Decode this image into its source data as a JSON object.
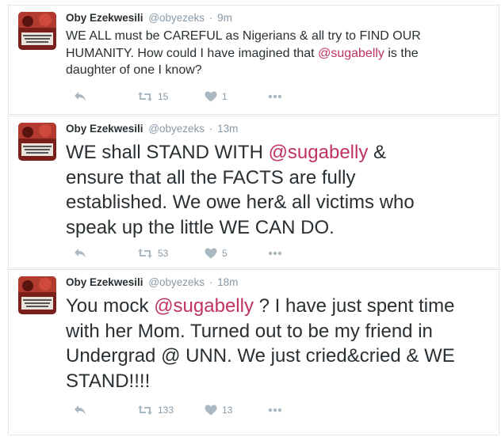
{
  "tweets": [
    {
      "fullname": "Oby Ezekwesili",
      "username": "@obyezeks",
      "separator": "·",
      "time": "9m",
      "text_parts": [
        "WE ALL must be CAREFUL as Nigerians & all try to FIND OUR HUMANITY. How could I have imagined that ",
        "@sugabelly",
        " is the daughter of one I know?"
      ],
      "retweets": "15",
      "likes": "1"
    },
    {
      "fullname": "Oby Ezekwesili",
      "username": "@obyezeks",
      "separator": "·",
      "time": "13m",
      "text_parts": [
        "WE shall STAND WITH ",
        "@sugabelly",
        " & ensure that all the FACTS are fully established. We owe her& all victims who speak up the little WE CAN DO."
      ],
      "retweets": "53",
      "likes": "5"
    },
    {
      "fullname": "Oby Ezekwesili",
      "username": "@obyezeks",
      "separator": "·",
      "time": "18m",
      "text_parts": [
        "You mock ",
        "@sugabelly",
        " ? I have just spent time with her Mom. Turned out to be my friend in Undergrad @ UNN. We just cried&cried & WE STAND!!!!"
      ],
      "retweets": "133",
      "likes": "13"
    }
  ],
  "avatar_text": "Bring Back Our Girls",
  "icons": {
    "reply": "reply-icon",
    "retweet": "retweet-icon",
    "like": "heart-icon",
    "more": "more-icon"
  },
  "colors": {
    "mention": "#c0335f",
    "icon": "#aab8c2",
    "meta": "#8899a6",
    "text": "#292f33",
    "avatar_red": "#c0392b"
  }
}
